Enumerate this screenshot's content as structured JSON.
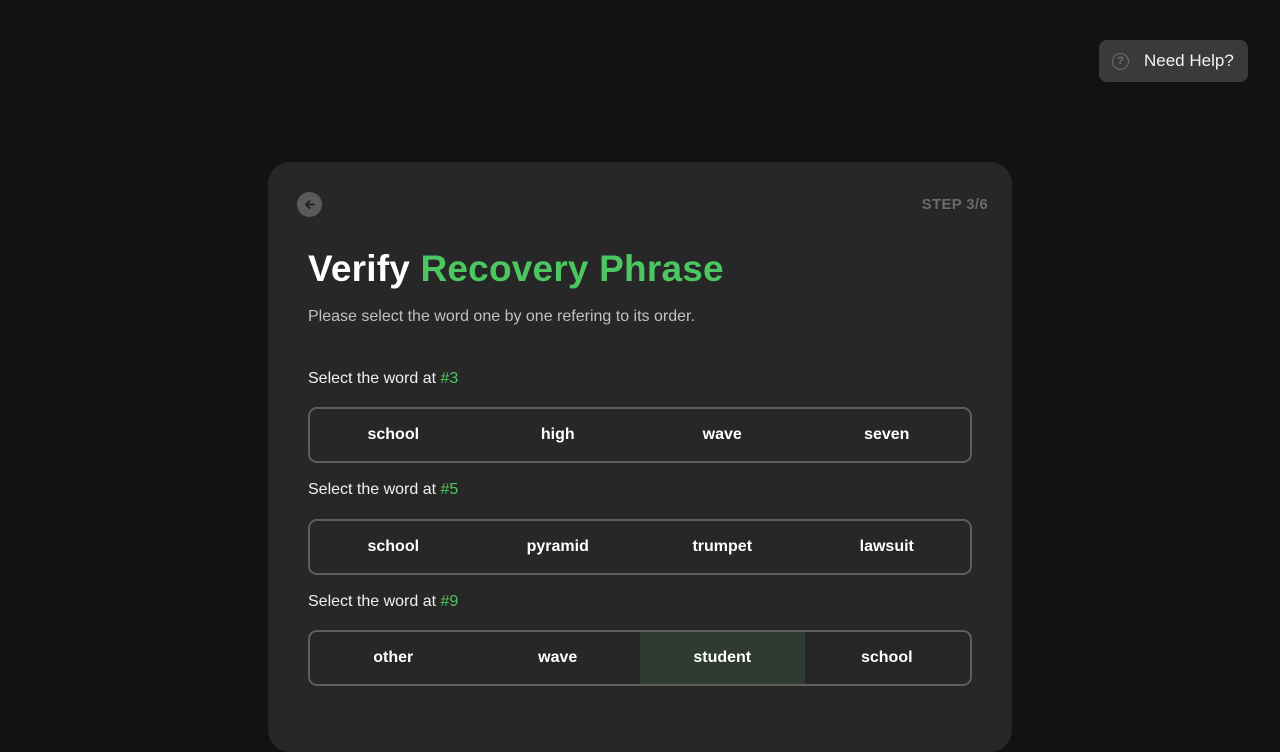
{
  "help": {
    "label": "Need Help?",
    "icon": "question-circle-icon"
  },
  "card": {
    "step": "STEP 3/6",
    "title_main": "Verify",
    "title_accent": "Recovery Phrase",
    "subtitle": "Please select the word one by one refering to its order.",
    "accent_color": "#4cc661"
  },
  "questions": [
    {
      "prompt": "Select the word at ",
      "number": "#3",
      "options": [
        "school",
        "high",
        "wave",
        "seven"
      ],
      "selected": null
    },
    {
      "prompt": "Select the word at ",
      "number": "#5",
      "options": [
        "school",
        "pyramid",
        "trumpet",
        "lawsuit"
      ],
      "selected": null
    },
    {
      "prompt": "Select the word at ",
      "number": "#9",
      "options": [
        "other",
        "wave",
        "student",
        "school"
      ],
      "selected": "student"
    }
  ]
}
